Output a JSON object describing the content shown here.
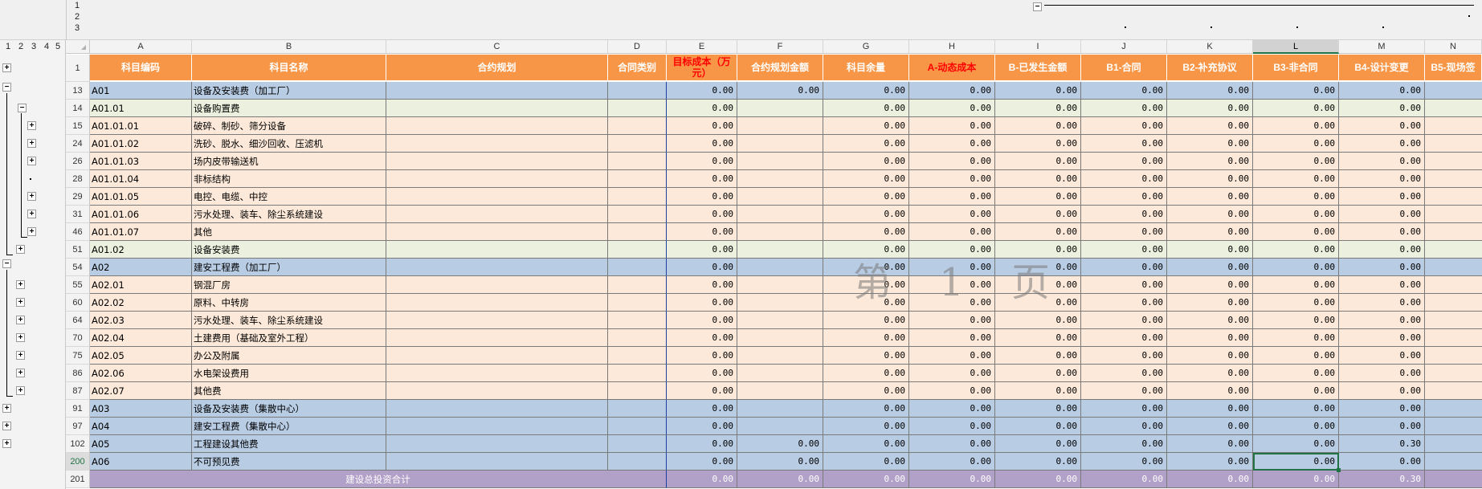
{
  "outline": {
    "column_levels": [
      "1",
      "2",
      "3"
    ],
    "row_levels": [
      "1",
      "2",
      "3",
      "4",
      "5"
    ],
    "collapse_symbol": "−",
    "expand_symbol": "+",
    "dot_symbol": "·"
  },
  "column_headers": [
    "A",
    "B",
    "C",
    "D",
    "E",
    "F",
    "G",
    "H",
    "I",
    "J",
    "K",
    "L",
    "M",
    "N"
  ],
  "selected_column": "L",
  "header_row": {
    "row_number": "1",
    "labels": [
      "科目编码",
      "科目名称",
      "合约规划",
      "合同类别",
      "目标成本（万元）",
      "合约规划金额",
      "科目余量",
      "A-动态成本",
      "B-已发生金额",
      "B1-合同",
      "B2-补充协议",
      "B3-非合同",
      "B4-设计变更",
      "B5-现场签"
    ],
    "red_columns": [
      4,
      7
    ]
  },
  "rows": [
    {
      "num": "13",
      "code": "A01",
      "name": "设备及安装费（加工厂）",
      "fill": "blue",
      "values": [
        "0.00",
        "0.00",
        "0.00",
        "0.00",
        "0.00",
        "0.00",
        "0.00",
        "0.00",
        "0.00"
      ]
    },
    {
      "num": "14",
      "code": "A01.01",
      "name": "设备购置费",
      "fill": "green",
      "values": [
        "0.00",
        "",
        "0.00",
        "0.00",
        "0.00",
        "0.00",
        "0.00",
        "0.00",
        "0.00"
      ]
    },
    {
      "num": "15",
      "code": "A01.01.01",
      "name": "破碎、制砂、筛分设备",
      "fill": "peach",
      "values": [
        "0.00",
        "",
        "0.00",
        "0.00",
        "0.00",
        "0.00",
        "0.00",
        "0.00",
        "0.00"
      ]
    },
    {
      "num": "24",
      "code": "A01.01.02",
      "name": "洗砂、脱水、细沙回收、压滤机",
      "fill": "peach",
      "values": [
        "0.00",
        "",
        "0.00",
        "0.00",
        "0.00",
        "0.00",
        "0.00",
        "0.00",
        "0.00"
      ]
    },
    {
      "num": "26",
      "code": "A01.01.03",
      "name": "场内皮带输送机",
      "fill": "peach",
      "values": [
        "0.00",
        "",
        "0.00",
        "0.00",
        "0.00",
        "0.00",
        "0.00",
        "0.00",
        "0.00"
      ]
    },
    {
      "num": "28",
      "code": "A01.01.04",
      "name": "非标结构",
      "fill": "peach",
      "values": [
        "0.00",
        "",
        "0.00",
        "0.00",
        "0.00",
        "0.00",
        "0.00",
        "0.00",
        "0.00"
      ]
    },
    {
      "num": "29",
      "code": "A01.01.05",
      "name": "电控、电缆、中控",
      "fill": "peach",
      "values": [
        "0.00",
        "",
        "0.00",
        "0.00",
        "0.00",
        "0.00",
        "0.00",
        "0.00",
        "0.00"
      ]
    },
    {
      "num": "31",
      "code": "A01.01.06",
      "name": "污水处理、装车、除尘系统建设",
      "fill": "peach",
      "values": [
        "0.00",
        "",
        "0.00",
        "0.00",
        "0.00",
        "0.00",
        "0.00",
        "0.00",
        "0.00"
      ]
    },
    {
      "num": "46",
      "code": "A01.01.07",
      "name": "其他",
      "fill": "peach",
      "values": [
        "0.00",
        "",
        "0.00",
        "0.00",
        "0.00",
        "0.00",
        "0.00",
        "0.00",
        "0.00"
      ]
    },
    {
      "num": "51",
      "code": "A01.02",
      "name": "设备安装费",
      "fill": "green",
      "values": [
        "0.00",
        "",
        "0.00",
        "0.00",
        "0.00",
        "0.00",
        "0.00",
        "0.00",
        "0.00"
      ]
    },
    {
      "num": "54",
      "code": "A02",
      "name": "建安工程费（加工厂）",
      "fill": "blue",
      "values": [
        "0.00",
        "",
        "0.00",
        "0.00",
        "0.00",
        "0.00",
        "0.00",
        "0.00",
        "0.00"
      ]
    },
    {
      "num": "55",
      "code": "A02.01",
      "name": "钢混厂房",
      "fill": "peach",
      "values": [
        "0.00",
        "",
        "0.00",
        "0.00",
        "0.00",
        "0.00",
        "0.00",
        "0.00",
        "0.00"
      ]
    },
    {
      "num": "60",
      "code": "A02.02",
      "name": "原料、中转房",
      "fill": "peach",
      "values": [
        "0.00",
        "",
        "0.00",
        "0.00",
        "0.00",
        "0.00",
        "0.00",
        "0.00",
        "0.00"
      ]
    },
    {
      "num": "64",
      "code": "A02.03",
      "name": "污水处理、装车、除尘系统建设",
      "fill": "peach",
      "values": [
        "0.00",
        "",
        "0.00",
        "0.00",
        "0.00",
        "0.00",
        "0.00",
        "0.00",
        "0.00"
      ]
    },
    {
      "num": "70",
      "code": "A02.04",
      "name": "土建费用（基础及室外工程）",
      "fill": "peach",
      "values": [
        "0.00",
        "",
        "0.00",
        "0.00",
        "0.00",
        "0.00",
        "0.00",
        "0.00",
        "0.00"
      ]
    },
    {
      "num": "75",
      "code": "A02.05",
      "name": "办公及附属",
      "fill": "peach",
      "values": [
        "0.00",
        "",
        "0.00",
        "0.00",
        "0.00",
        "0.00",
        "0.00",
        "0.00",
        "0.00"
      ]
    },
    {
      "num": "86",
      "code": "A02.06",
      "name": "水电架设费用",
      "fill": "peach",
      "values": [
        "0.00",
        "",
        "0.00",
        "0.00",
        "0.00",
        "0.00",
        "0.00",
        "0.00",
        "0.00"
      ]
    },
    {
      "num": "87",
      "code": "A02.07",
      "name": "其他费",
      "fill": "peach",
      "values": [
        "0.00",
        "",
        "0.00",
        "0.00",
        "0.00",
        "0.00",
        "0.00",
        "0.00",
        "0.00"
      ]
    },
    {
      "num": "91",
      "code": "A03",
      "name": "设备及安装费（集散中心）",
      "fill": "blue",
      "values": [
        "0.00",
        "",
        "0.00",
        "0.00",
        "0.00",
        "0.00",
        "0.00",
        "0.00",
        "0.00"
      ]
    },
    {
      "num": "97",
      "code": "A04",
      "name": "建安工程费（集散中心）",
      "fill": "blue",
      "values": [
        "0.00",
        "",
        "0.00",
        "0.00",
        "0.00",
        "0.00",
        "0.00",
        "0.00",
        "0.00"
      ]
    },
    {
      "num": "102",
      "code": "A05",
      "name": "工程建设其他费",
      "fill": "blue",
      "values": [
        "0.00",
        "0.00",
        "0.00",
        "0.00",
        "0.00",
        "0.00",
        "0.00",
        "0.00",
        "0.30"
      ]
    },
    {
      "num": "200",
      "code": "A06",
      "name": "不可预见费",
      "fill": "blue",
      "values": [
        "0.00",
        "0.00",
        "0.00",
        "0.00",
        "0.00",
        "0.00",
        "0.00",
        "0.00",
        "0.00"
      ]
    },
    {
      "num": "201",
      "code": "",
      "name": "建设总投资合计",
      "fill": "purple",
      "values": [
        "0.00",
        "0.00",
        "0.00",
        "0.00",
        "0.00",
        "0.00",
        "0.00",
        "0.00",
        "0.30"
      ]
    }
  ],
  "watermark": "第 1 页",
  "colors": {
    "header": "#f79646",
    "level1": "#b8cce4",
    "level2": "#ebf1de",
    "level3": "#fde9d9",
    "total": "#b1a0c7",
    "accent": "#217346",
    "red": "#ff0000"
  }
}
